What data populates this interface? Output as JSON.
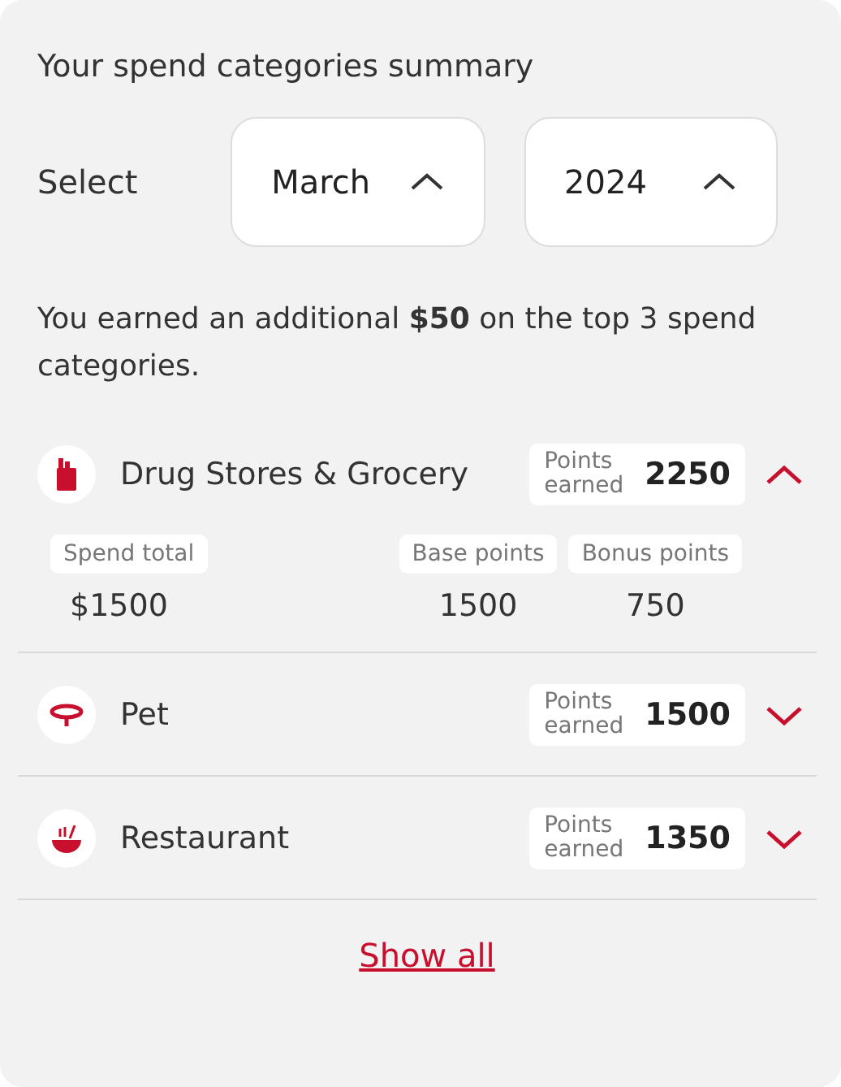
{
  "title": "Your spend categories summary",
  "select": {
    "label": "Select",
    "dropdowns": [
      {
        "value": "March",
        "expanded": true
      },
      {
        "value": "2024",
        "expanded": true
      }
    ]
  },
  "message": "You earned an additional **$50** on the top 3 spend categories.",
  "categories": [
    {
      "kind": "grocery",
      "name": "Drug Stores & Grocery",
      "points_label": "Points earned",
      "points": "2250",
      "expanded": true,
      "details": [
        {
          "label": "Spend total",
          "value": "$1500"
        },
        {
          "label": "Base points",
          "value": "1500"
        },
        {
          "label": "Bonus points",
          "value": "750"
        }
      ]
    },
    {
      "kind": "pet",
      "name": "Pet",
      "points_label": "Points earned",
      "points": "1500",
      "expanded": false
    },
    {
      "kind": "restaurant",
      "name": "Restaurant",
      "points_label": "Points earned",
      "points": "1350",
      "expanded": false
    }
  ],
  "show_all": "Show all"
}
